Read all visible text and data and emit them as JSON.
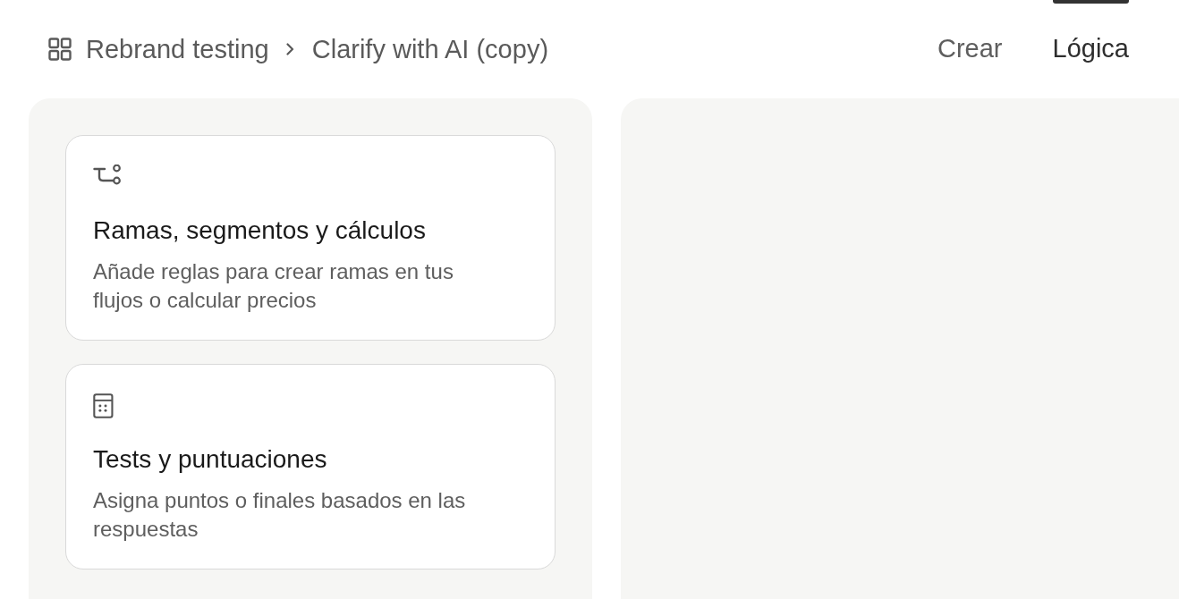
{
  "breadcrumb": {
    "items": [
      {
        "label": "Rebrand testing"
      },
      {
        "label": "Clarify with AI (copy)"
      }
    ]
  },
  "tabs": [
    {
      "label": "Crear",
      "selected": false
    },
    {
      "label": "Lógica",
      "selected": true
    }
  ],
  "logic_panel": {
    "cards": [
      {
        "kind": "branch",
        "title": "Ramas, segmentos y cálculos",
        "description": "Añade reglas para crear ramas en tus flujos o calcular precios"
      },
      {
        "kind": "calculator",
        "title": "Tests y puntuaciones",
        "description": "Asigna puntos o finales basados en las respuestas"
      }
    ]
  }
}
